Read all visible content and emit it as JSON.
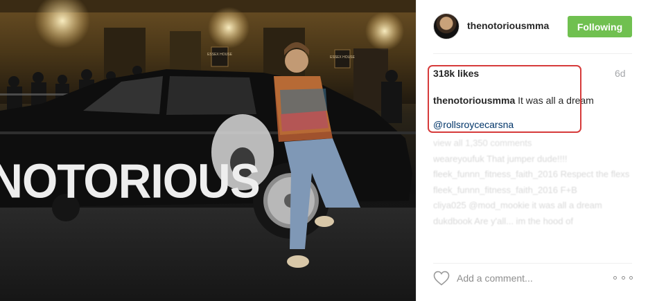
{
  "post": {
    "username": "thenotoriousmma",
    "follow_label": "Following",
    "likes": "318k likes",
    "time_ago": "6d",
    "caption_author": "thenotoriousmma",
    "caption_text": " It was all a dream",
    "mention": "@rollsroycecarsna"
  },
  "photo": {
    "car_text": "NOTORIOUS",
    "sign_text_1": "ESSEX HOUSE",
    "sign_text_2": "ESSEX HOUSE"
  },
  "comments": [
    "view all 1,350 comments",
    "weareyoufuk That jumper dude!!!!",
    "fleek_funnn_fitness_faith_2016 Respect the flexs",
    "fleek_funnn_fitness_faith_2016 F+B",
    "cliya025 @mod_mookie it was all a dream",
    "dukdbook Are y'all... im the hood of"
  ],
  "add_comment_placeholder": "Add a comment...",
  "colors": {
    "follow_bg": "#70c050",
    "highlight_border": "#d63a3a",
    "link": "#003569"
  },
  "icons": {
    "like": "heart-outline-icon",
    "more": "more-options-icon"
  }
}
